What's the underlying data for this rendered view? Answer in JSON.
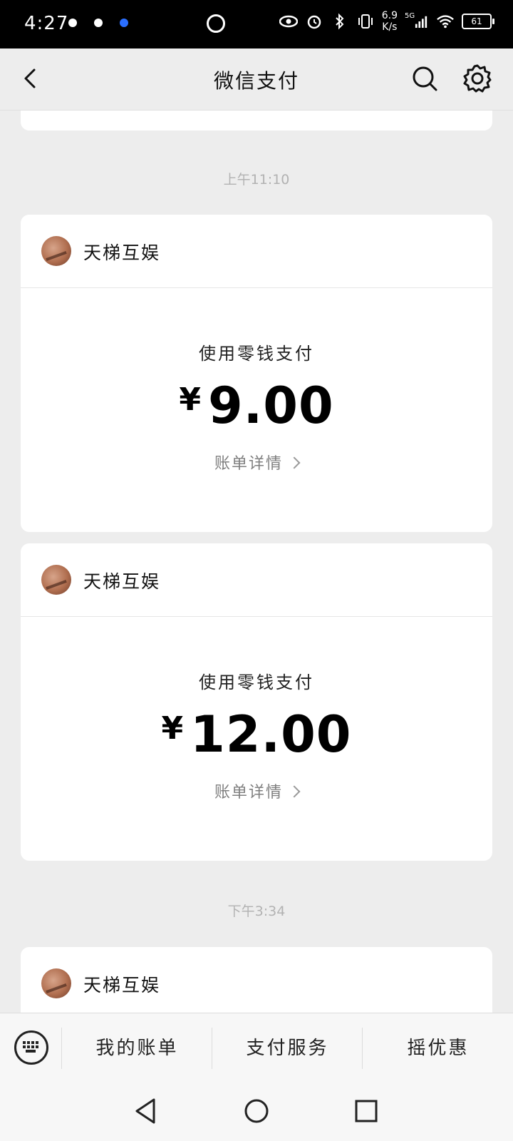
{
  "status_bar": {
    "time": "4:27",
    "speed_top": "6.9",
    "speed_bottom": "K/s",
    "network": "5G",
    "battery": "61"
  },
  "nav": {
    "title": "微信支付"
  },
  "timeline": {
    "time_1": "上午11:10",
    "time_2": "下午3:34"
  },
  "cards": [
    {
      "merchant": "天梯互娱",
      "method": "使用零钱支付",
      "currency": "¥",
      "amount": "9.00",
      "detail": "账单详情"
    },
    {
      "merchant": "天梯互娱",
      "method": "使用零钱支付",
      "currency": "¥",
      "amount": "12.00",
      "detail": "账单详情"
    },
    {
      "merchant": "天梯互娱"
    }
  ],
  "bottom_menu": {
    "item1": "我的账单",
    "item2": "支付服务",
    "item3": "摇优惠"
  }
}
